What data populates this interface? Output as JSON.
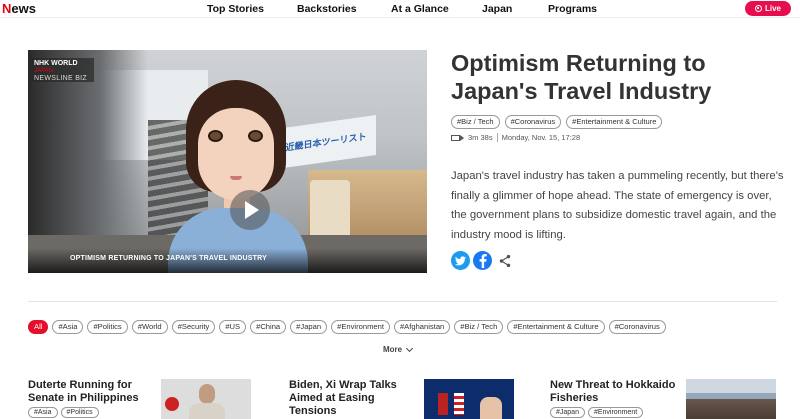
{
  "header": {
    "logo_text": "News",
    "nav": [
      "Top Stories",
      "Backstories",
      "At a Glance",
      "Japan",
      "Programs"
    ],
    "live_label": "Live",
    "live_color": "#e60e4e"
  },
  "video": {
    "logo_brand": "NHK WORLD",
    "logo_sub": "JAPAN",
    "program": "NEWSLINE BIZ",
    "sign_text": "近畿日本ツーリスト",
    "caption": "OPTIMISM RETURNING TO JAPAN'S TRAVEL INDUSTRY"
  },
  "article": {
    "title": "Optimism Returning to Japan's Travel Industry",
    "tags": [
      "#Biz / Tech",
      "#Coronavirus",
      "#Entertainment & Culture"
    ],
    "duration": "3m 38s",
    "date": "Monday, Nov. 15, 17:28",
    "summary": "Japan's travel industry has taken a pummeling recently, but there's finally a glimmer of hope ahead. The state of emergency is over, the government plans to subsidize domestic travel again, and the industry mood is lifting."
  },
  "share": {
    "twitter_icon": "twitter-icon",
    "facebook_icon": "facebook-icon",
    "share_icon": "share-icon"
  },
  "filters": {
    "items": [
      "All",
      "#Asia",
      "#Politics",
      "#World",
      "#Security",
      "#US",
      "#China",
      "#Japan",
      "#Environment",
      "#Afghanistan",
      "#Biz / Tech",
      "#Entertainment & Culture",
      "#Coronavirus"
    ],
    "active": "All",
    "more_label": "More"
  },
  "cards": [
    {
      "title": "Duterte Running for Senate in Philippines",
      "tags": [
        "#Asia",
        "#Politics"
      ]
    },
    {
      "title": "Biden, Xi Wrap Talks Aimed at Easing Tensions",
      "tags": []
    },
    {
      "title": "New Threat to Hokkaido Fisheries",
      "tags": [
        "#Japan",
        "#Environment"
      ]
    }
  ],
  "colors": {
    "accent": "#e60012",
    "tag_border": "#999999"
  }
}
